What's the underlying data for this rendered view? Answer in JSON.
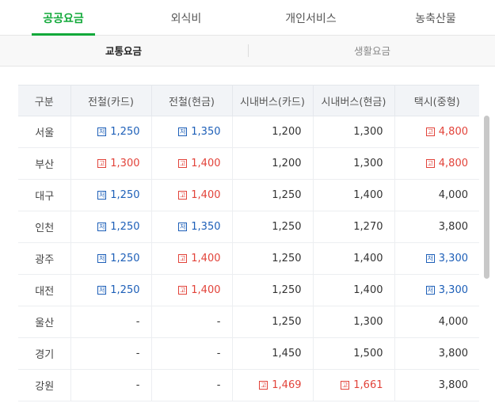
{
  "tabs": [
    "공공요금",
    "외식비",
    "개인서비스",
    "농축산물"
  ],
  "subtabs": [
    "교통요금",
    "생활요금"
  ],
  "table": {
    "headers": [
      "구분",
      "전철(카드)",
      "전철(현금)",
      "시내버스(카드)",
      "시내버스(현금)",
      "택시(중형)"
    ],
    "rows": [
      {
        "region": "서울",
        "cells": [
          {
            "v": "1,250",
            "b": "저"
          },
          {
            "v": "1,350",
            "b": "저"
          },
          {
            "v": "1,200",
            "b": ""
          },
          {
            "v": "1,300",
            "b": ""
          },
          {
            "v": "4,800",
            "b": "고"
          }
        ]
      },
      {
        "region": "부산",
        "cells": [
          {
            "v": "1,300",
            "b": "고"
          },
          {
            "v": "1,400",
            "b": "고"
          },
          {
            "v": "1,200",
            "b": ""
          },
          {
            "v": "1,300",
            "b": ""
          },
          {
            "v": "4,800",
            "b": "고"
          }
        ]
      },
      {
        "region": "대구",
        "cells": [
          {
            "v": "1,250",
            "b": "저"
          },
          {
            "v": "1,400",
            "b": "고"
          },
          {
            "v": "1,250",
            "b": ""
          },
          {
            "v": "1,400",
            "b": ""
          },
          {
            "v": "4,000",
            "b": ""
          }
        ]
      },
      {
        "region": "인천",
        "cells": [
          {
            "v": "1,250",
            "b": "저"
          },
          {
            "v": "1,350",
            "b": "저"
          },
          {
            "v": "1,250",
            "b": ""
          },
          {
            "v": "1,270",
            "b": ""
          },
          {
            "v": "3,800",
            "b": ""
          }
        ]
      },
      {
        "region": "광주",
        "cells": [
          {
            "v": "1,250",
            "b": "저"
          },
          {
            "v": "1,400",
            "b": "고"
          },
          {
            "v": "1,250",
            "b": ""
          },
          {
            "v": "1,400",
            "b": ""
          },
          {
            "v": "3,300",
            "b": "저"
          }
        ]
      },
      {
        "region": "대전",
        "cells": [
          {
            "v": "1,250",
            "b": "저"
          },
          {
            "v": "1,400",
            "b": "고"
          },
          {
            "v": "1,250",
            "b": ""
          },
          {
            "v": "1,400",
            "b": ""
          },
          {
            "v": "3,300",
            "b": "저"
          }
        ]
      },
      {
        "region": "울산",
        "cells": [
          {
            "v": "-",
            "b": ""
          },
          {
            "v": "-",
            "b": ""
          },
          {
            "v": "1,250",
            "b": ""
          },
          {
            "v": "1,300",
            "b": ""
          },
          {
            "v": "4,000",
            "b": ""
          }
        ]
      },
      {
        "region": "경기",
        "cells": [
          {
            "v": "-",
            "b": ""
          },
          {
            "v": "-",
            "b": ""
          },
          {
            "v": "1,450",
            "b": ""
          },
          {
            "v": "1,500",
            "b": ""
          },
          {
            "v": "3,800",
            "b": ""
          }
        ]
      },
      {
        "region": "강원",
        "cells": [
          {
            "v": "-",
            "b": ""
          },
          {
            "v": "-",
            "b": ""
          },
          {
            "v": "1,469",
            "b": "고"
          },
          {
            "v": "1,661",
            "b": "고"
          },
          {
            "v": "3,800",
            "b": ""
          }
        ]
      }
    ]
  },
  "colors": {
    "accent": "#12a93a",
    "low": "#1d5fb8",
    "high": "#e2433a"
  }
}
